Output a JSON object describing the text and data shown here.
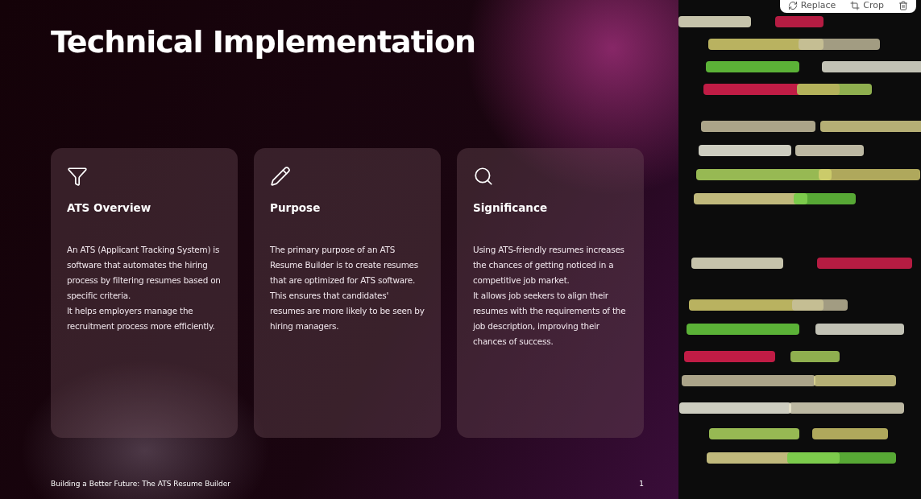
{
  "slide": {
    "title": "Technical Implementation",
    "cards": [
      {
        "kind": "filter",
        "heading": "ATS Overview",
        "paragraphs": [
          "An ATS (Applicant Tracking System) is software that automates the hiring process by filtering resumes based on specific criteria.",
          "It helps employers manage the recruitment process more efficiently."
        ]
      },
      {
        "kind": "pencil",
        "heading": "Purpose",
        "paragraphs": [
          "The primary purpose of an ATS Resume Builder is to create resumes that are optimized for ATS software.",
          "This ensures that candidates' resumes are more likely to be seen by hiring managers."
        ]
      },
      {
        "kind": "search",
        "heading": "Significance",
        "paragraphs": [
          "Using ATS-friendly resumes increases the chances of getting noticed in a competitive job market.",
          "It allows job seekers to align their resumes with the requirements of the job description, improving their chances of success."
        ]
      }
    ],
    "footer": "Building a Better Future: The ATS Resume Builder",
    "page_number": "1"
  },
  "image_toolbar": {
    "buttons": [
      {
        "kind": "replace",
        "label": "Replace"
      },
      {
        "kind": "crop",
        "label": "Crop"
      },
      {
        "kind": "delete"
      }
    ]
  }
}
